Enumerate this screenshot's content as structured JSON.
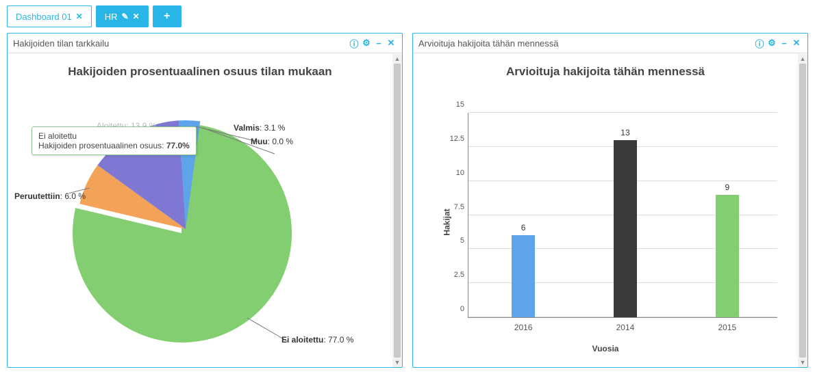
{
  "tabs": {
    "items": [
      {
        "label": "Dashboard 01",
        "active": false
      },
      {
        "label": "HR",
        "active": true
      }
    ],
    "add_label": "+"
  },
  "panel1": {
    "title": "Hakijoiden tilan tarkkailu",
    "chart_title": "Hakijoiden prosentuaalinen osuus tilan mukaan",
    "tooltip": {
      "line1": "Ei aloitettu",
      "line2_label": "Hakijoiden prosentuaalinen osuus:",
      "line2_value": "77.0%"
    },
    "labels": {
      "aloitettu": "Aloitettu: 13.9 %",
      "valmis_k": "Valmis",
      "valmis_v": ": 3.1 %",
      "muu_k": "Muu",
      "muu_v": ": 0.0 %",
      "peru_k": "Peruutettiin",
      "peru_v": ": 6.0 %",
      "ei_k": "Ei aloitettu",
      "ei_v": ": 77.0 %"
    }
  },
  "panel2": {
    "title": "Arvioituja hakijoita tähän mennessä",
    "chart_title": "Arvioituja hakijoita tähän mennessä",
    "ylabel": "Hakijat",
    "xlabel": "Vuosia",
    "yticks": [
      "0",
      "2.5",
      "5",
      "7.5",
      "10",
      "12.5",
      "15"
    ],
    "bars": [
      {
        "cat": "2016",
        "val": "6"
      },
      {
        "cat": "2014",
        "val": "13"
      },
      {
        "cat": "2015",
        "val": "9"
      }
    ]
  },
  "chart_data": [
    {
      "type": "pie",
      "title": "Hakijoiden prosentuaalinen osuus tilan mukaan",
      "series": [
        {
          "name": "Ei aloitettu",
          "value": 77.0,
          "color": "#82ce70"
        },
        {
          "name": "Peruutettiin",
          "value": 6.0,
          "color": "#f4a258"
        },
        {
          "name": "Aloitettu",
          "value": 13.9,
          "color": "#7e78d2"
        },
        {
          "name": "Valmis",
          "value": 3.1,
          "color": "#5da5e8"
        },
        {
          "name": "Muu",
          "value": 0.0,
          "color": "#cccccc"
        }
      ],
      "highlighted": "Ei aloitettu",
      "tooltip": {
        "category": "Ei aloitettu",
        "metric": "Hakijoiden prosentuaalinen osuus",
        "value": 77.0,
        "unit": "%"
      }
    },
    {
      "type": "bar",
      "title": "Arvioituja hakijoita tähän mennessä",
      "xlabel": "Vuosia",
      "ylabel": "Hakijat",
      "ylim": [
        0,
        15
      ],
      "categories": [
        "2016",
        "2014",
        "2015"
      ],
      "values": [
        6,
        13,
        9
      ],
      "colors": [
        "#5da5e8",
        "#3a3a3a",
        "#82ce70"
      ]
    }
  ]
}
